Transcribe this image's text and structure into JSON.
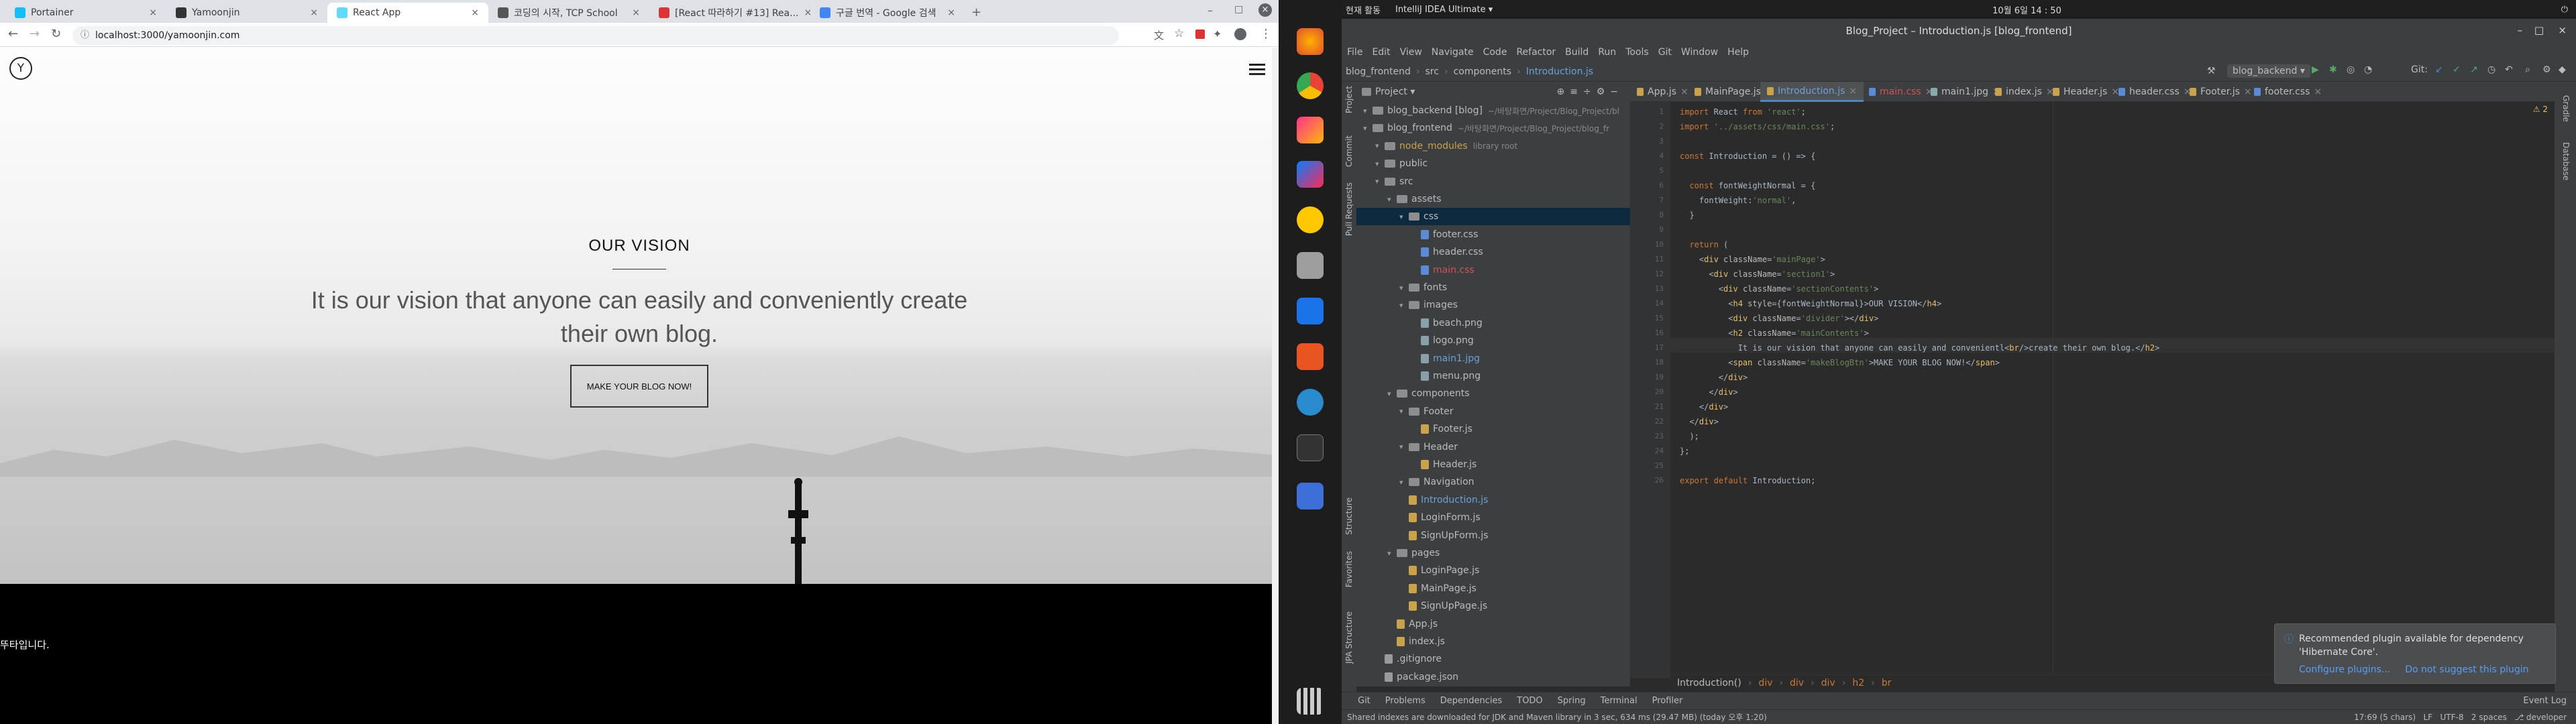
{
  "browser": {
    "tabs": [
      {
        "label": "Portainer",
        "color": "#13bef9"
      },
      {
        "label": "Yamoonjin",
        "color": "#333333"
      },
      {
        "label": "React App",
        "color": "#61dafb",
        "active": true
      },
      {
        "label": "코딩의 시작, TCP School",
        "color": "#555555"
      },
      {
        "label": "[React 따라하기 #13] Rea...",
        "color": "#d33"
      },
      {
        "label": "구글 번역 - Google 검색",
        "color": "#4285f4"
      }
    ],
    "url": "localhost:3000/yamoonjin.com",
    "logo": "Y",
    "vision_title": "OUR VISION",
    "vision_text": "It is our vision that anyone can easily and conveniently create their own blog.",
    "cta": "MAKE YOUR BLOG NOW!",
    "footer_text": "뚜타입니다."
  },
  "system": {
    "activity": "현재 활동",
    "app": "IntelliJ IDEA Ultimate ▾",
    "clock": "10월 6일  14 : 50"
  },
  "ide": {
    "title": "Blog_Project – Introduction.js [blog_frontend]",
    "menu": [
      "File",
      "Edit",
      "View",
      "Navigate",
      "Code",
      "Refactor",
      "Build",
      "Run",
      "Tools",
      "Git",
      "Window",
      "Help"
    ],
    "nav_crumbs": [
      "blog_frontend",
      "src",
      "components",
      "Introduction.js"
    ],
    "run_config": "blog_backend ▾",
    "git_label": "Git:",
    "project_label": "Project ▾",
    "editor_tabs": [
      "App.js",
      "MainPage.js",
      "Introduction.js",
      "main.css",
      "main1.jpg",
      "index.js",
      "Header.js",
      "header.css",
      "Footer.js",
      "footer.css"
    ],
    "tree": [
      {
        "label": "blog_backend [blog]",
        "hint": "~/바탕화면/Project/Blog_Project/bl",
        "indent": 0,
        "type": "folder"
      },
      {
        "label": "blog_frontend",
        "hint": "~/바탕화면/Project/Blog_Project/blog_fr",
        "indent": 0,
        "type": "folder"
      },
      {
        "label": "node_modules",
        "hint": "library root",
        "indent": 1,
        "type": "folder"
      },
      {
        "label": "public",
        "hint": "",
        "indent": 1,
        "type": "folder"
      },
      {
        "label": "src",
        "hint": "",
        "indent": 1,
        "type": "folder"
      },
      {
        "label": "assets",
        "hint": "",
        "indent": 2,
        "type": "folder"
      },
      {
        "label": "css",
        "hint": "",
        "indent": 3,
        "type": "folder",
        "selected": true
      },
      {
        "label": "footer.css",
        "hint": "",
        "indent": 4,
        "type": "css"
      },
      {
        "label": "header.css",
        "hint": "",
        "indent": 4,
        "type": "css"
      },
      {
        "label": "main.css",
        "hint": "",
        "indent": 4,
        "type": "css-red"
      },
      {
        "label": "fonts",
        "hint": "",
        "indent": 3,
        "type": "folder"
      },
      {
        "label": "images",
        "hint": "",
        "indent": 3,
        "type": "folder"
      },
      {
        "label": "beach.png",
        "hint": "",
        "indent": 4,
        "type": "img"
      },
      {
        "label": "logo.png",
        "hint": "",
        "indent": 4,
        "type": "img"
      },
      {
        "label": "main1.jpg",
        "hint": "",
        "indent": 4,
        "type": "img-blue"
      },
      {
        "label": "menu.png",
        "hint": "",
        "indent": 4,
        "type": "img"
      },
      {
        "label": "components",
        "hint": "",
        "indent": 2,
        "type": "folder"
      },
      {
        "label": "Footer",
        "hint": "",
        "indent": 3,
        "type": "folder"
      },
      {
        "label": "Footer.js",
        "hint": "",
        "indent": 4,
        "type": "js"
      },
      {
        "label": "Header",
        "hint": "",
        "indent": 3,
        "type": "folder"
      },
      {
        "label": "Header.js",
        "hint": "",
        "indent": 4,
        "type": "js"
      },
      {
        "label": "Navigation",
        "hint": "",
        "indent": 3,
        "type": "folder"
      },
      {
        "label": "Introduction.js",
        "hint": "",
        "indent": 3,
        "type": "js-blue"
      },
      {
        "label": "LoginForm.js",
        "hint": "",
        "indent": 3,
        "type": "js"
      },
      {
        "label": "SignUpForm.js",
        "hint": "",
        "indent": 3,
        "type": "js"
      },
      {
        "label": "pages",
        "hint": "",
        "indent": 2,
        "type": "folder"
      },
      {
        "label": "LoginPage.js",
        "hint": "",
        "indent": 3,
        "type": "js"
      },
      {
        "label": "MainPage.js",
        "hint": "",
        "indent": 3,
        "type": "js"
      },
      {
        "label": "SignUpPage.js",
        "hint": "",
        "indent": 3,
        "type": "js"
      },
      {
        "label": "App.js",
        "hint": "",
        "indent": 2,
        "type": "js"
      },
      {
        "label": "index.js",
        "hint": "",
        "indent": 2,
        "type": "js"
      },
      {
        "label": ".gitignore",
        "hint": "",
        "indent": 1,
        "type": "file"
      },
      {
        "label": "package.json",
        "hint": "",
        "indent": 1,
        "type": "file"
      }
    ],
    "code": [
      "import React from 'react';",
      "import '../assets/css/main.css';",
      "",
      "const Introduction = () => {",
      "",
      "  const fontWeightNormal = {",
      "    fontWeight:'normal',",
      "  }",
      "",
      "  return (",
      "    <div className='mainPage'>",
      "      <div className='section1'>",
      "        <div className='sectionContents'>",
      "          <h4 style={fontWeightNormal}>OUR VISION</h4>",
      "          <div className='divider'></div>",
      "          <h2 className='mainContents'>",
      "            It is our vision that anyone can easily and convenientl<br/>create their own blog.</h2>",
      "          <span className='makeBlogBtn'>MAKE YOUR BLOG NOW!</span>",
      "        </div>",
      "      </div>",
      "    </div>",
      "  </div>",
      "  );",
      "};",
      "",
      "export default Introduction;"
    ],
    "warnings": "⚠ 2",
    "breadcrumb": [
      "Introduction()",
      "div",
      "div",
      "div",
      "h2",
      "br"
    ],
    "bottom_tools": [
      "Git",
      "Problems",
      "Dependencies",
      "TODO",
      "Spring",
      "Terminal",
      "Profiler"
    ],
    "event_log": "Event Log",
    "status": "Shared indexes are downloaded for JDK and Maven library in 3 sec, 634 ms (29.47 MB) (today 오후 1:20)",
    "status_right": "17:69 (5 chars)   LF   UTF-8   2 spaces   ⎇ developer",
    "notification": {
      "title": "Recommended plugin available for dependency 'Hibernate Core'.",
      "configure": "Configure plugins...",
      "dismiss": "Do not suggest this plugin"
    },
    "side_tools_left": [
      "Project",
      "Commit",
      "Pull Requests",
      "Structure",
      "Favorites",
      "JPA Structure"
    ],
    "side_tools_right": [
      "Gradle",
      "Database"
    ]
  }
}
